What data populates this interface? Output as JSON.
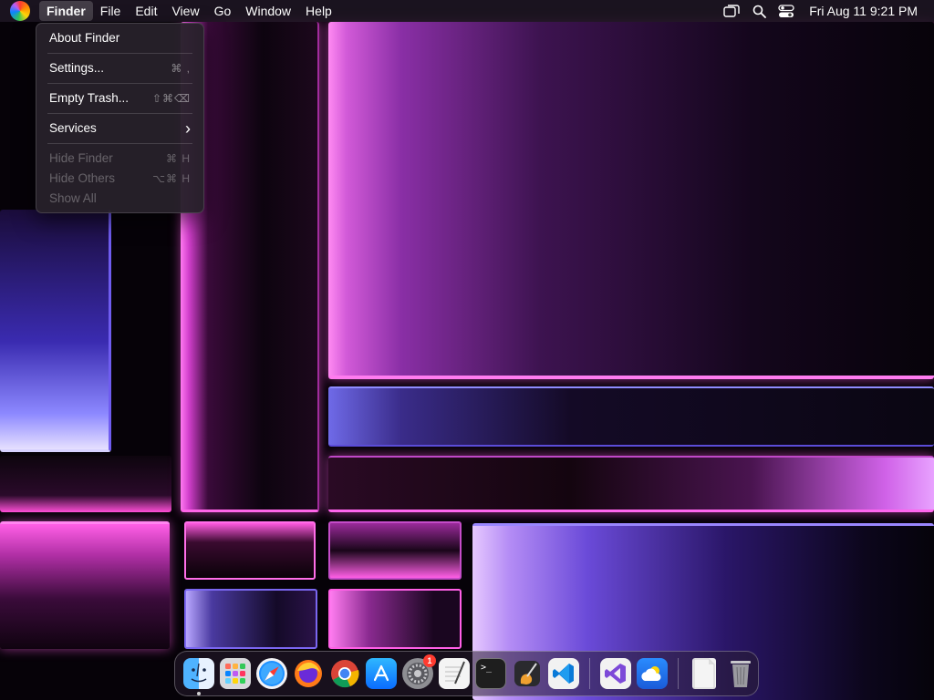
{
  "menubar": {
    "app_name": "Finder",
    "items": [
      "File",
      "Edit",
      "View",
      "Go",
      "Window",
      "Help"
    ],
    "clock": "Fri Aug 11  9:21 PM"
  },
  "dropdown": {
    "about": "About Finder",
    "settings": {
      "label": "Settings...",
      "shortcut": "⌘ ,"
    },
    "empty_trash": {
      "label": "Empty Trash...",
      "shortcut": "⇧⌘⌫"
    },
    "services": {
      "label": "Services",
      "arrow": "›"
    },
    "hide_finder": {
      "label": "Hide Finder",
      "shortcut": "⌘ H"
    },
    "hide_others": {
      "label": "Hide Others",
      "shortcut": "⌥⌘ H"
    },
    "show_all": {
      "label": "Show All"
    }
  },
  "dock": {
    "settings_badge": "1",
    "terminal_prompt": ">_"
  },
  "colors": {
    "menu_bg": "#1e1622",
    "dropdown_bg": "#26202a",
    "badge": "#ff3b30",
    "wallpaper_pink": "#ff5fe6",
    "wallpaper_violet": "#6f5cf0"
  },
  "icons": {
    "menubar": [
      "apple-logo",
      "screen-mirroring-icon",
      "search-icon",
      "control-center-icon"
    ],
    "dock": [
      "finder-icon",
      "launchpad-icon",
      "safari-icon",
      "firefox-icon",
      "chrome-icon",
      "app-store-icon",
      "system-settings-icon",
      "textedit-icon",
      "terminal-icon",
      "instruments-icon",
      "vscode-icon",
      "visual-studio-icon",
      "weather-icon",
      "document-icon",
      "trash-icon"
    ]
  }
}
